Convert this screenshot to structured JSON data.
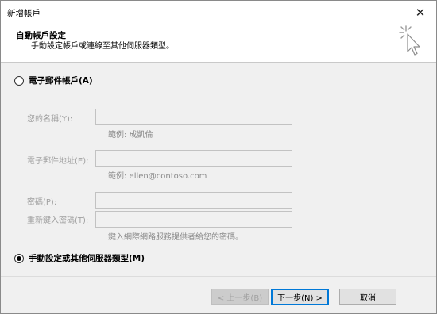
{
  "window": {
    "title": "新增帳戶",
    "close_glyph": "✕"
  },
  "header": {
    "title": "自動帳戶設定",
    "subtitle": "手動設定帳戶或連線至其他伺服器類型。",
    "icon": "wizard-cursor-icon"
  },
  "options": {
    "email_account": {
      "label": "電子郵件帳戶(A)",
      "checked": false
    },
    "manual_setup": {
      "label": "手動設定或其他伺服器類型(M)",
      "checked": true
    }
  },
  "form": {
    "name": {
      "label": "您的名稱(Y):",
      "value": "",
      "hint": "範例: 成凱倫"
    },
    "email": {
      "label": "電子郵件地址(E):",
      "value": "",
      "hint": "範例: ellen@contoso.com"
    },
    "password": {
      "label": "密碼(P):",
      "value": ""
    },
    "retype_password": {
      "label": "重新鍵入密碼(T):",
      "value": ""
    },
    "password_hint": "鍵入網際網路服務提供者給您的密碼。"
  },
  "buttons": {
    "back": "< 上一步(B)",
    "next": "下一步(N) >",
    "cancel": "取消"
  }
}
